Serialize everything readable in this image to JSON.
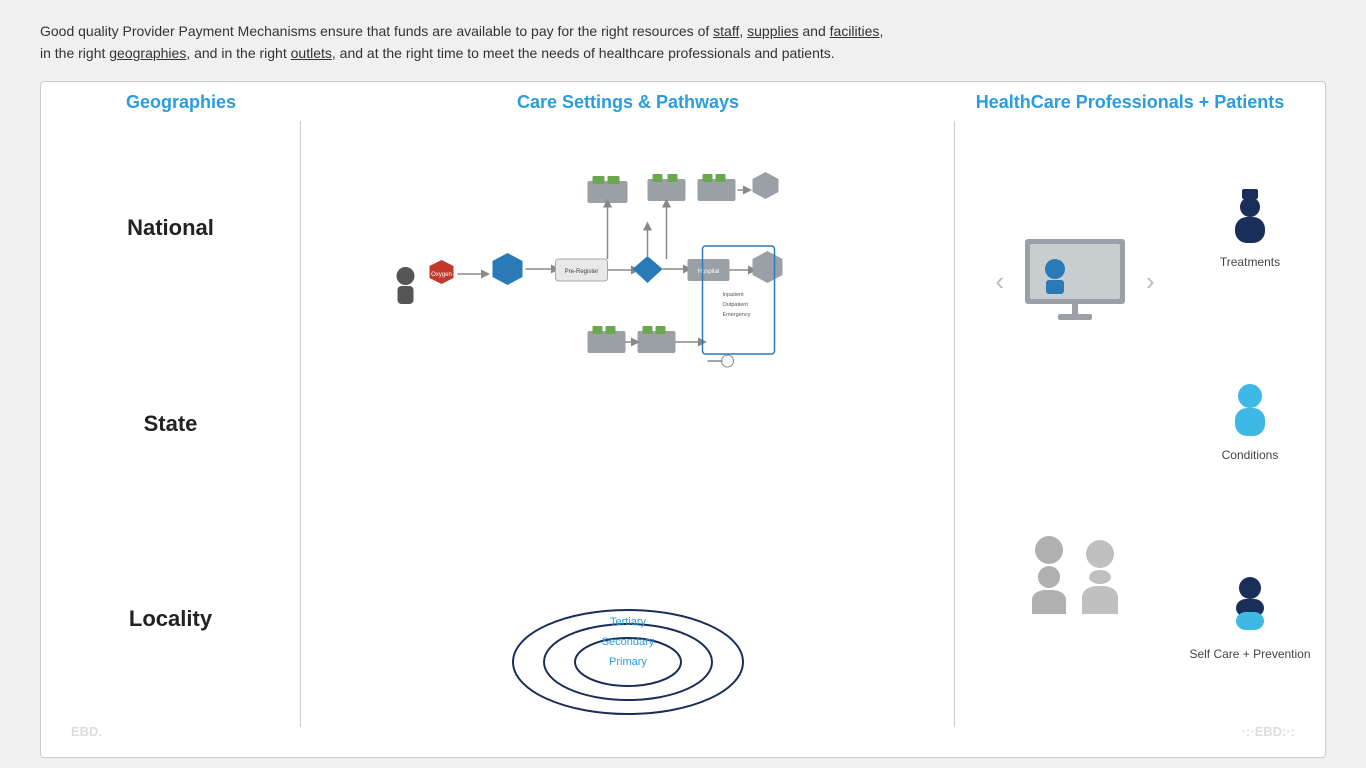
{
  "intro": {
    "text1": "Good quality Provider Payment Mechanisms ensure that funds are available to pay for the right resources of ",
    "underline1": "staff",
    "text2": ", ",
    "underline2": "supplies",
    "text3": " and ",
    "underline3": "facilities",
    "text4": ",",
    "text5": "in the right ",
    "underline4": "geographies",
    "text6": ", and in the right ",
    "underline5": "outlets",
    "text7": ", and at the right time to meet the needs of healthcare professionals and patients."
  },
  "columns": {
    "geo_title": "Geographies",
    "care_title": "Care Settings & Pathways",
    "hcp_title": "HealthCare Professionals + Patients"
  },
  "geographies": {
    "national": "National",
    "state": "State",
    "locality": "Locality"
  },
  "care_settings": {
    "tertiary": "Tertiary",
    "secondary": "Secondary",
    "primary": "Primary"
  },
  "hcp": {
    "treatments_label": "Treatments",
    "conditions_label": "Conditions",
    "selfcare_label": "Self Care + Prevention"
  },
  "footer": {
    "left": "EBD.",
    "right": "·:·EBD:·:"
  },
  "nav": {
    "prev": "‹",
    "next": "›"
  }
}
